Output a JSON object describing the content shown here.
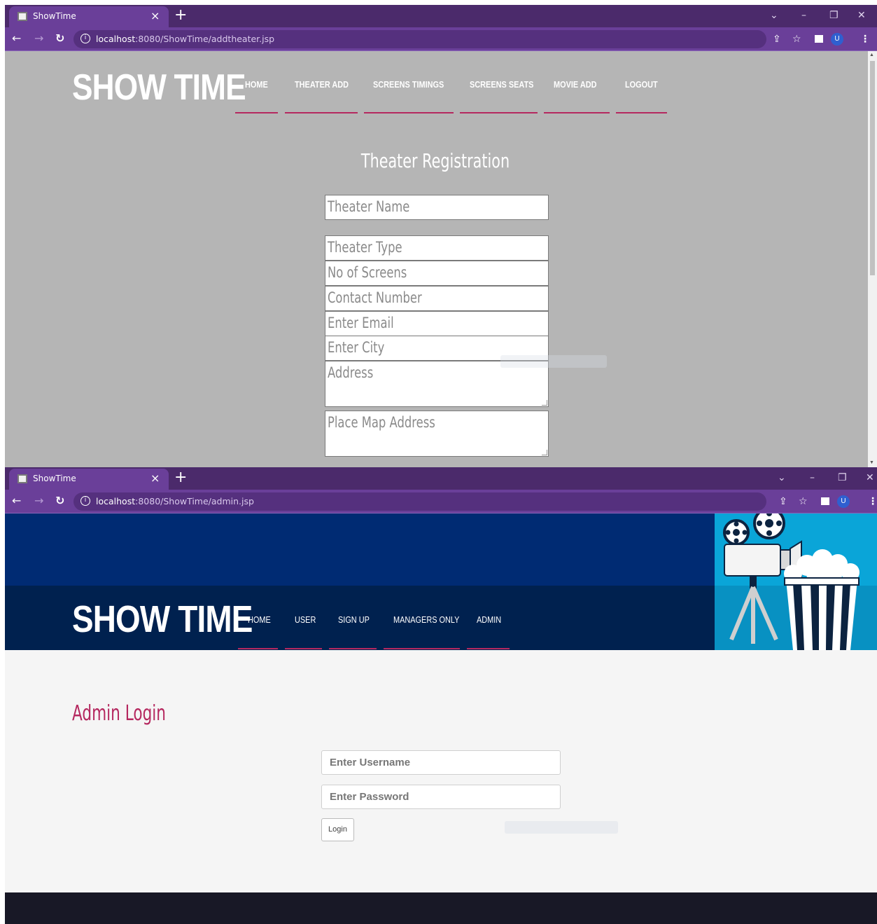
{
  "window1": {
    "tab": {
      "title": "ShowTime",
      "close": "×",
      "new_tab": "+"
    },
    "controls": {
      "dropdown": "⌄",
      "minimize": "–",
      "restore": "❐",
      "close": "✕"
    },
    "address": {
      "host": "localhost",
      "rest": ":8080/ShowTime/addtheater.jsp"
    },
    "profile_initial": "U",
    "site": {
      "logo": "SHOW TIME",
      "menu": [
        "HOME",
        "THEATER ADD",
        "SCREENS TIMINGS",
        "SCREENS SEATS",
        "MOVIE ADD",
        "LOGOUT"
      ]
    },
    "form": {
      "title": "Theater Registration",
      "fields": {
        "theater_name": "Theater Name",
        "theater_type": "Theater Type",
        "no_of_screens": "No of Screens",
        "contact_number": "Contact Number",
        "email": "Enter Email",
        "city": "Enter City",
        "address": "Address",
        "map_address": "Place Map Address"
      }
    }
  },
  "window2": {
    "tab": {
      "title": "ShowTime",
      "close": "×",
      "new_tab": "+"
    },
    "controls": {
      "dropdown": "⌄",
      "minimize": "–",
      "restore": "❐",
      "close": "✕"
    },
    "address": {
      "host": "localhost",
      "rest": ":8080/ShowTime/admin.jsp"
    },
    "profile_initial": "U",
    "site": {
      "logo": "SHOW TIME",
      "menu": [
        "HOME",
        "USER",
        "SIGN UP",
        "MANAGERS ONLY",
        "ADMIN"
      ]
    },
    "login": {
      "title": "Admin Login",
      "username_placeholder": "Enter Username",
      "password_placeholder": "Enter Password",
      "button": "Login"
    }
  },
  "colors": {
    "chrome_dark": "#4b2a6b",
    "chrome_light": "#6a3f99",
    "accent_pink": "#b5285f",
    "hero_blue": "#002b73",
    "nav_navy": "#00214f",
    "art_cyan": "#0aa5d8",
    "page_gray": "#b5b5b5"
  }
}
